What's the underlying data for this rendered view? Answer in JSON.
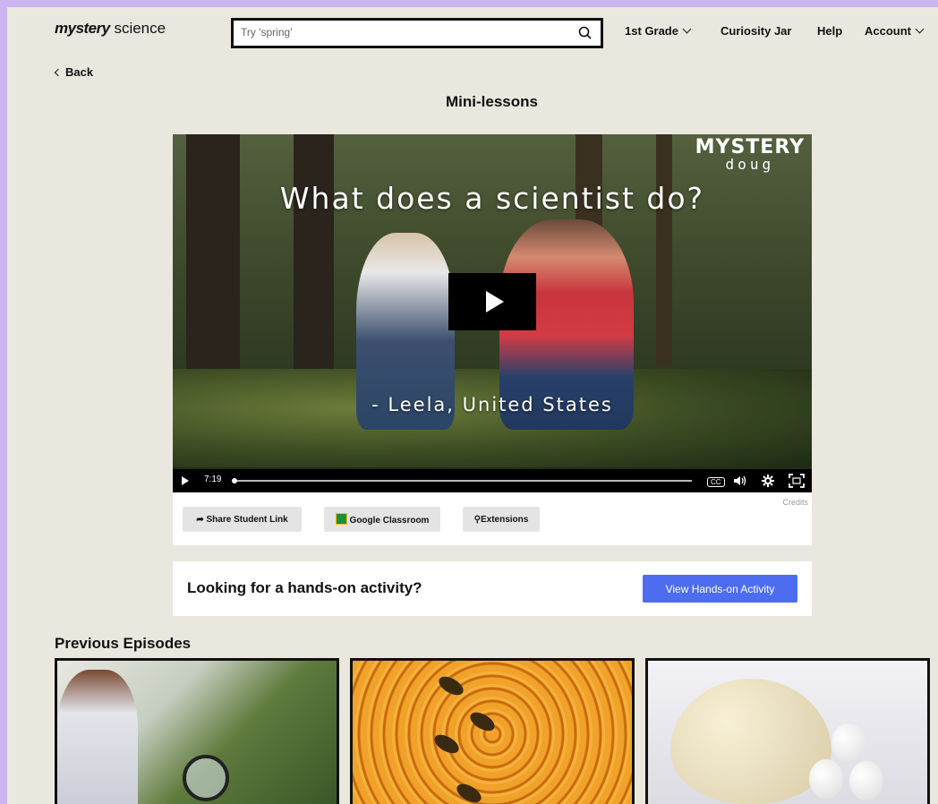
{
  "header": {
    "logo_bold": "mystery",
    "logo_light": "science",
    "search_placeholder": "Try 'spring'",
    "nav": {
      "grade": "1st Grade",
      "curiosity": "Curiosity Jar",
      "help": "Help",
      "account": "Account"
    }
  },
  "back_label": "Back",
  "page_title": "Mini-lessons",
  "video": {
    "title": "What does a scientist do?",
    "brand_top": "MYSTERY",
    "brand_bottom": "doug",
    "quote": "- Leela, United States",
    "time": "7:19",
    "progress": 0,
    "cc_label": "CC"
  },
  "actions": {
    "share": "Share Student Link",
    "google": "Google Classroom",
    "extensions": "Extensions",
    "credits": "Credits"
  },
  "handson": {
    "text": "Looking for a hands-on activity?",
    "button": "View Hands-on Activity"
  },
  "previous": {
    "title": "Previous Episodes"
  },
  "colors": {
    "accent": "#4e6cf0",
    "page_bg": "#eae8de",
    "outer_bg": "#cdb6f0"
  }
}
